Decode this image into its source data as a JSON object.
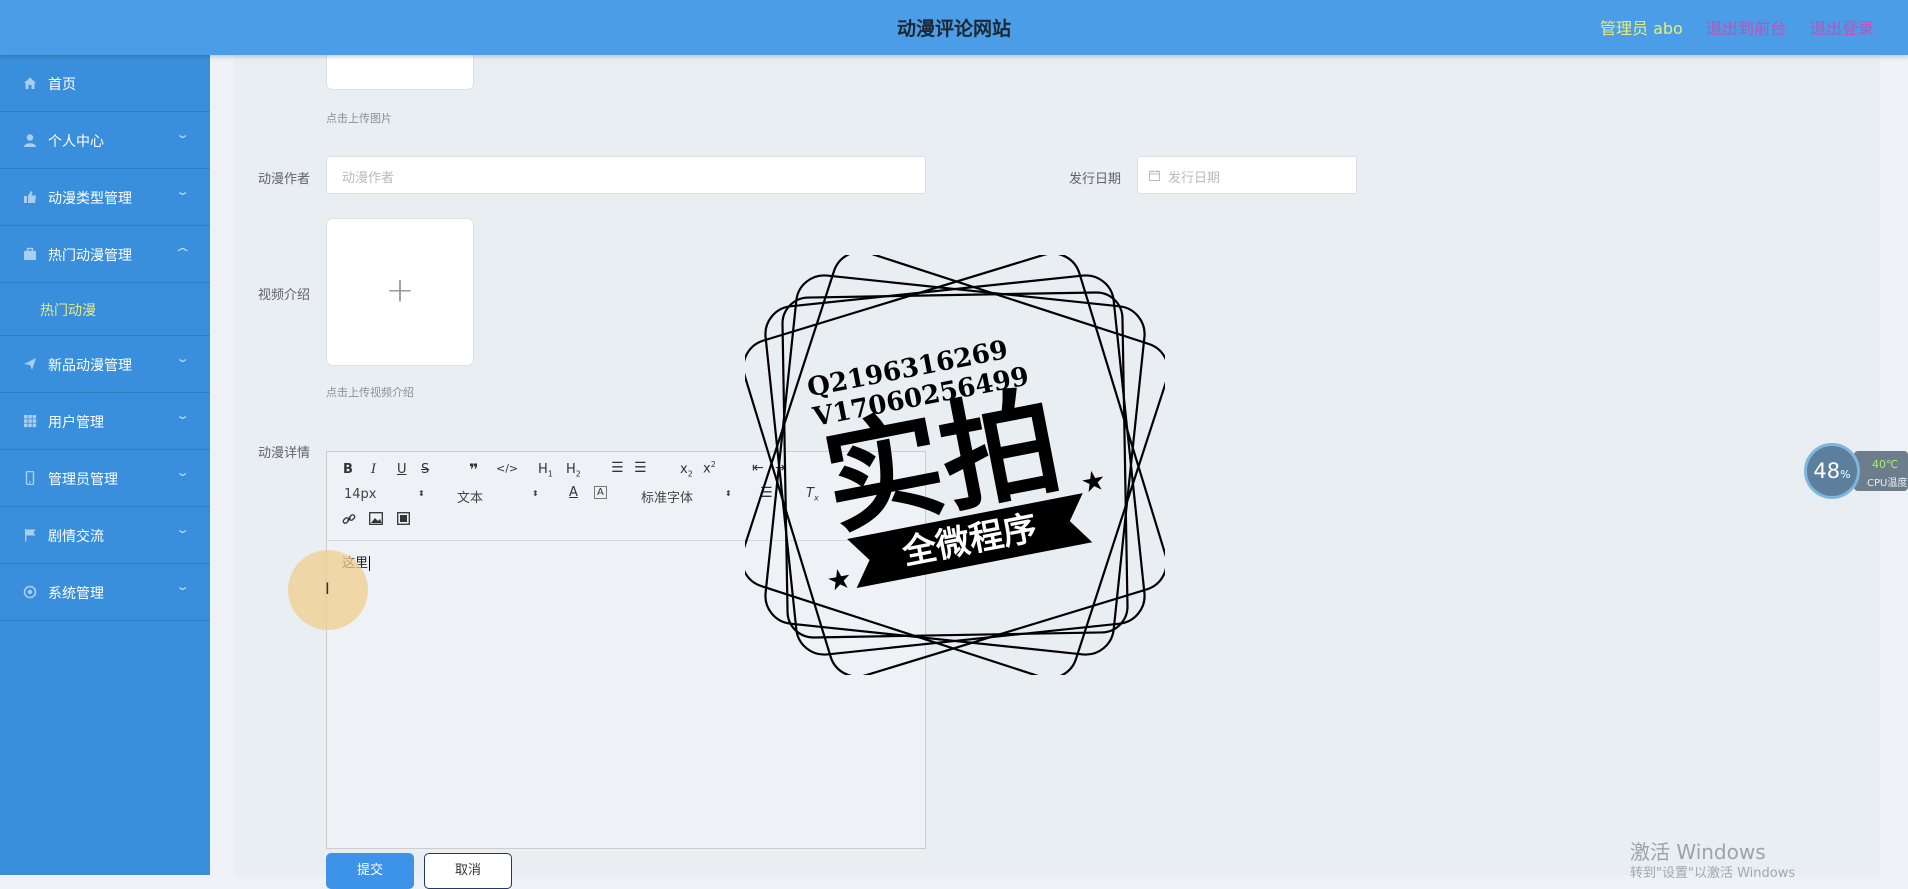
{
  "header": {
    "title": "动漫评论网站",
    "user": "管理员 abo",
    "exit_front": "退出到前台",
    "logout": "退出登录"
  },
  "sidebar": {
    "items": [
      {
        "label": "首页",
        "icon": "home-icon"
      },
      {
        "label": "个人中心",
        "icon": "user-icon"
      },
      {
        "label": "动漫类型管理",
        "icon": "thumb-icon"
      },
      {
        "label": "热门动漫管理",
        "icon": "briefcase-icon",
        "expanded": true,
        "children": [
          "热门动漫"
        ]
      },
      {
        "label": "新品动漫管理",
        "icon": "plane-icon"
      },
      {
        "label": "用户管理",
        "icon": "grid-icon"
      },
      {
        "label": "管理员管理",
        "icon": "phone-icon"
      },
      {
        "label": "剧情交流",
        "icon": "flag-icon"
      },
      {
        "label": "系统管理",
        "icon": "settings-icon"
      }
    ]
  },
  "form": {
    "image_hint": "点击上传图片",
    "author_label": "动漫作者",
    "author_placeholder": "动漫作者",
    "date_label": "发行日期",
    "date_placeholder": "发行日期",
    "video_label": "视频介绍",
    "video_hint": "点击上传视频介绍",
    "detail_label": "动漫详情",
    "editor": {
      "font_size": "14px",
      "block_format": "文本",
      "font_family": "标准字体",
      "content": "这里"
    },
    "submit": "提交",
    "cancel": "取消"
  },
  "watermark": {
    "line1": "Q2196316269",
    "line2": "V17060256499",
    "main": "实拍",
    "banner": "全微程序"
  },
  "cpu_widget": {
    "percent": "48",
    "unit": "%",
    "temp": "40℃",
    "caption": "CPU温度"
  },
  "windows_activation": {
    "title": "激活 Windows",
    "sub": "转到\"设置\"以激活 Windows"
  }
}
